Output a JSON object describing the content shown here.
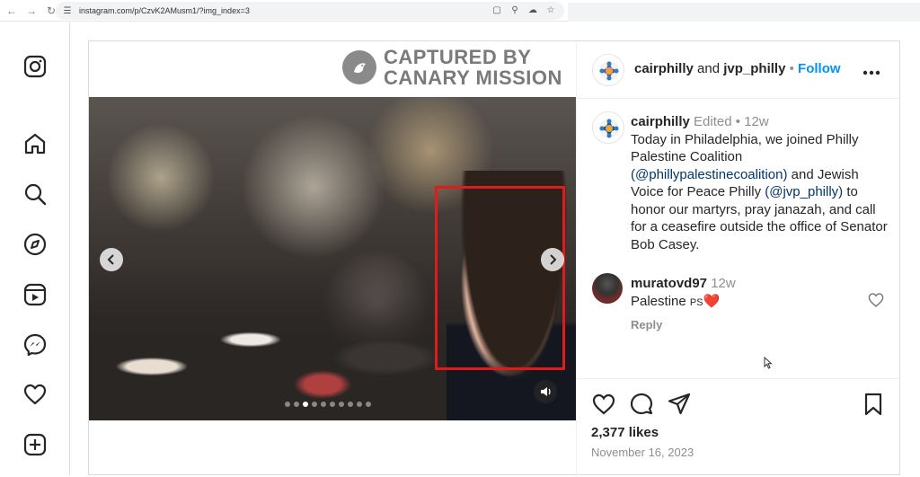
{
  "browser": {
    "url": "instagram.com/p/CzvK2AMusm1/?img_index=3"
  },
  "watermark": {
    "line1": "CAPTURED BY",
    "line2": "CANARY MISSION"
  },
  "carousel": {
    "total_slides": 10,
    "active_index": 2
  },
  "header": {
    "account1": "cairphilly",
    "joiner": "and",
    "account2": "jvp_philly",
    "separator": "•",
    "follow": "Follow"
  },
  "caption": {
    "username": "cairphilly",
    "edited": "Edited",
    "dot": "•",
    "time": "12w",
    "text_part1": "Today in Philadelphia, we joined Philly Palestine Coalition",
    "mention1": "(@phillypalestinecoalition)",
    "text_part2": "and Jewish Voice for Peace Philly",
    "mention2": "(@jvp_philly)",
    "text_part3": "to honor our martyrs, pray janazah, and call for a ceasefire outside the office of Senator Bob Casey."
  },
  "comment": {
    "username": "muratovd97",
    "time": "12w",
    "text": "Palestine",
    "flag": "PS",
    "heart": "❤️",
    "reply": "Reply"
  },
  "post_stats": {
    "likes": "2,377 likes",
    "date": "November 16, 2023"
  },
  "colors": {
    "accent_blue": "#0095f6",
    "face_box_red": "#e21a1a",
    "muted_text": "#8e8e8e"
  }
}
